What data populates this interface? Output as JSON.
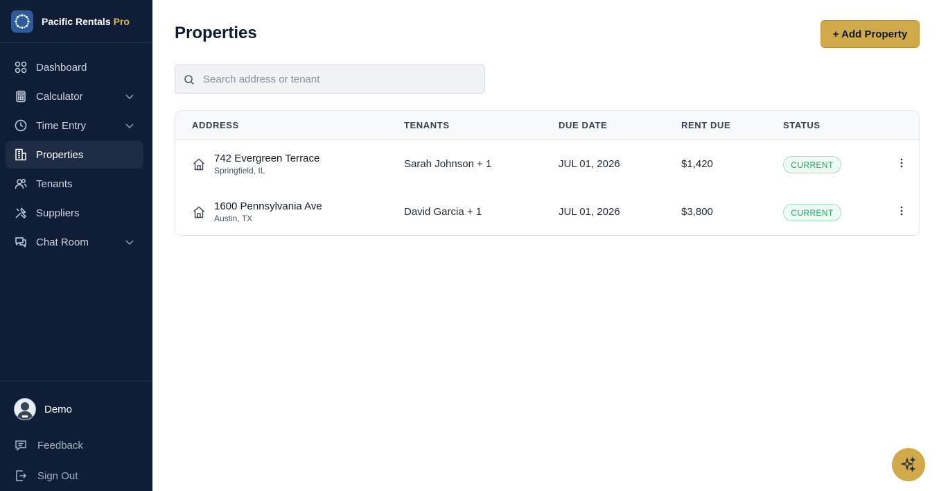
{
  "brand": {
    "name": "Pacific Rentals",
    "tier": "Pro"
  },
  "nav": [
    {
      "id": "dashboard",
      "label": "Dashboard",
      "icon": "dashboard-icon",
      "chevron": false,
      "active": false
    },
    {
      "id": "calculator",
      "label": "Calculator",
      "icon": "calculator-icon",
      "chevron": true,
      "active": false
    },
    {
      "id": "time-entry",
      "label": "Time Entry",
      "icon": "clock-icon",
      "chevron": true,
      "active": false
    },
    {
      "id": "properties",
      "label": "Properties",
      "icon": "building-icon",
      "chevron": false,
      "active": true
    },
    {
      "id": "tenants",
      "label": "Tenants",
      "icon": "users-icon",
      "chevron": false,
      "active": false
    },
    {
      "id": "suppliers",
      "label": "Suppliers",
      "icon": "tools-icon",
      "chevron": false,
      "active": false
    },
    {
      "id": "chat-room",
      "label": "Chat Room",
      "icon": "chat-icon",
      "chevron": true,
      "active": false
    }
  ],
  "user": {
    "name": "Demo"
  },
  "footer": {
    "feedback": "Feedback",
    "sign_out": "Sign Out"
  },
  "page": {
    "title": "Properties",
    "add_button": "+ Add Property"
  },
  "search": {
    "placeholder": "Search address or tenant",
    "value": ""
  },
  "table": {
    "headers": {
      "address": "ADDRESS",
      "tenants": "TENANTS",
      "due_date": "DUE DATE",
      "rent_due": "RENT DUE",
      "status": "STATUS"
    },
    "rows": [
      {
        "street": "742 Evergreen Terrace",
        "city": "Springfield, IL",
        "tenants": "Sarah Johnson + 1",
        "due_date": "JUL 01, 2026",
        "rent_due": "$1,420",
        "status": "CURRENT"
      },
      {
        "street": "1600 Pennsylvania Ave",
        "city": "Austin, TX",
        "tenants": "David Garcia + 1",
        "due_date": "JUL 01, 2026",
        "rent_due": "$3,800",
        "status": "CURRENT"
      }
    ]
  },
  "colors": {
    "sidebar": "#101d36",
    "accent": "#cfa94a",
    "status_current": "#1fa56a"
  }
}
